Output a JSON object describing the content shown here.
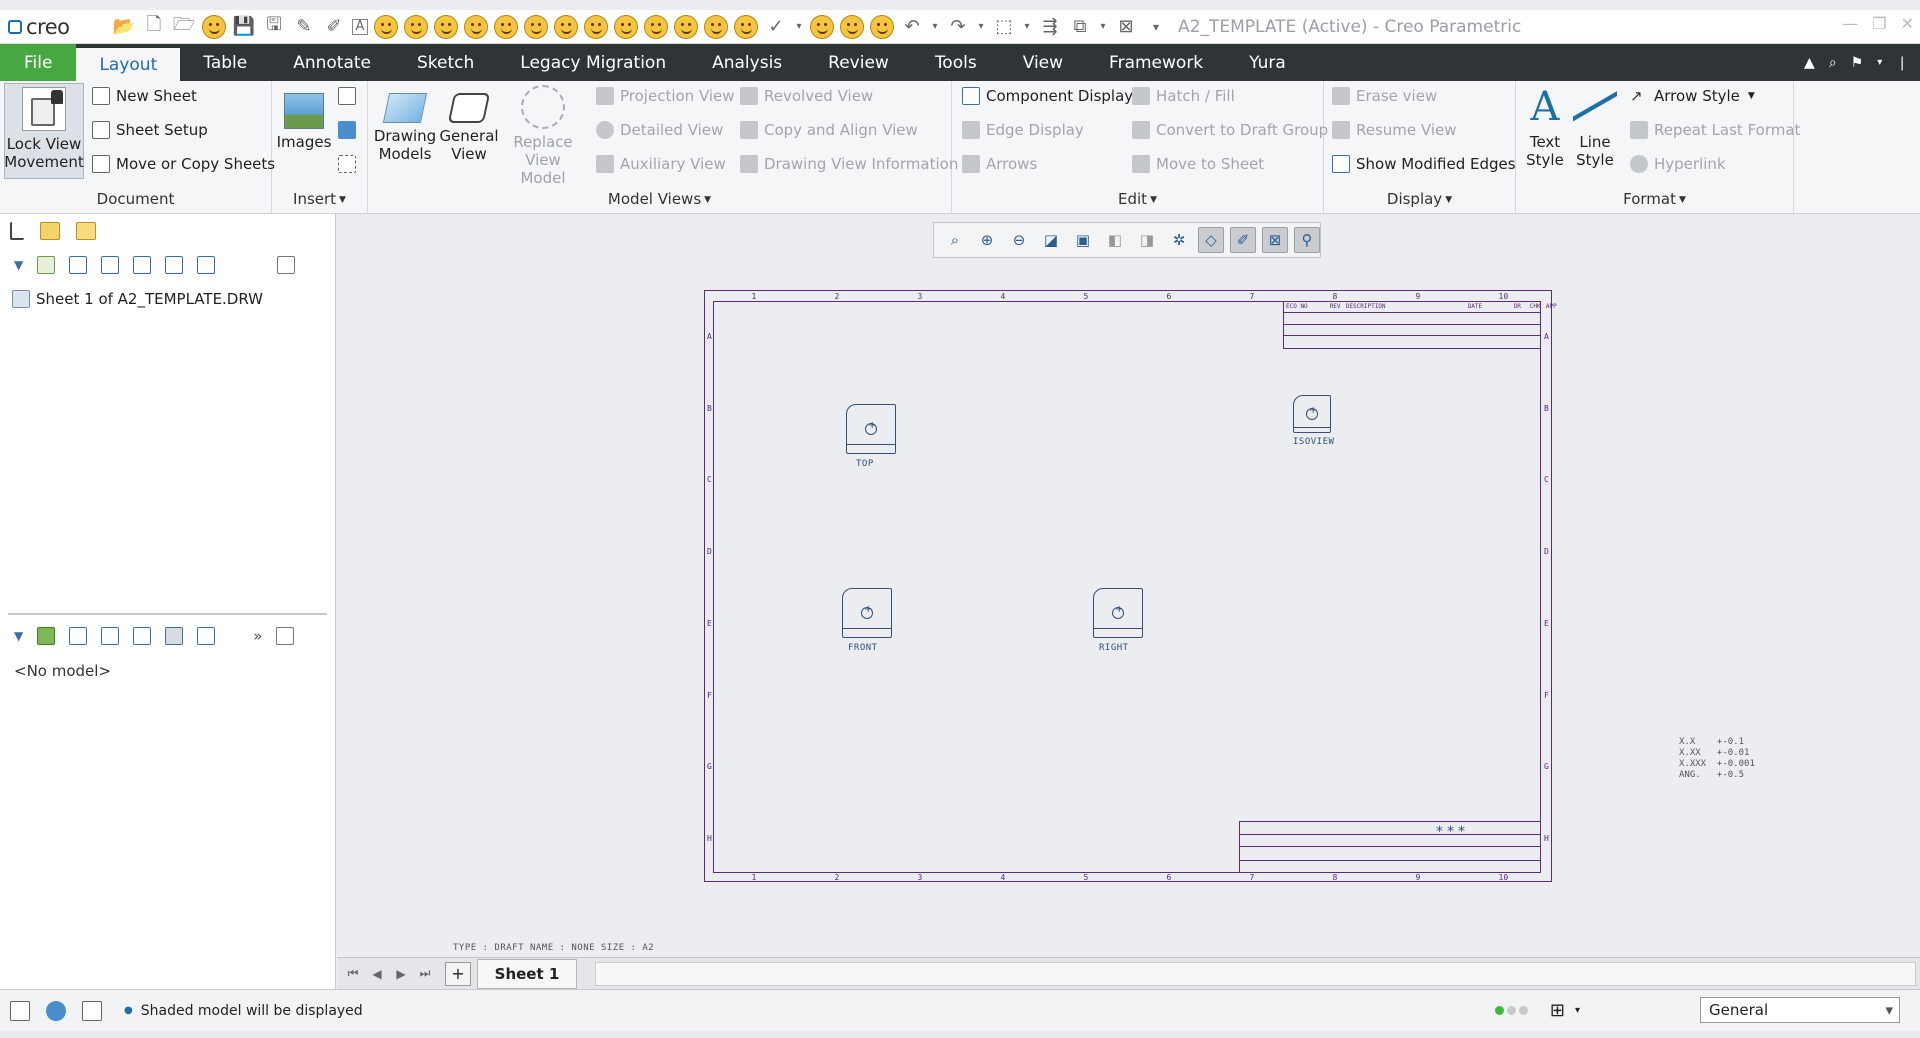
{
  "app": {
    "logo": "creo",
    "window_title": "A2_TEMPLATE (Active) - Creo Parametric"
  },
  "tabs": [
    "File",
    "Layout",
    "Table",
    "Annotate",
    "Sketch",
    "Legacy Migration",
    "Analysis",
    "Review",
    "Tools",
    "View",
    "Framework",
    "Yura"
  ],
  "active_tab": "Layout",
  "ribbon": {
    "document": {
      "label": "Document",
      "lock_view": "Lock View\nMovement",
      "new_sheet": "New Sheet",
      "sheet_setup": "Sheet Setup",
      "move_copy": "Move or Copy Sheets"
    },
    "insert": {
      "label": "Insert",
      "images": "Images"
    },
    "model_views": {
      "label": "Model Views",
      "drawing_models": "Drawing\nModels",
      "general_view": "General\nView",
      "replace_view": "Replace\nView Model",
      "projection_view": "Projection View",
      "detailed_view": "Detailed View",
      "auxiliary_view": "Auxiliary View",
      "revolved_view": "Revolved View",
      "copy_align": "Copy and Align View",
      "drawing_view_info": "Drawing View Information"
    },
    "edit": {
      "label": "Edit",
      "component_display": "Component Display",
      "edge_display": "Edge Display",
      "arrows": "Arrows",
      "hatch_fill": "Hatch / Fill",
      "convert_draft": "Convert to Draft Group",
      "move_to_sheet": "Move to Sheet"
    },
    "display": {
      "label": "Display",
      "erase_view": "Erase view",
      "resume_view": "Resume View",
      "show_modified": "Show Modified Edges"
    },
    "format": {
      "label": "Format",
      "text_style": "Text\nStyle",
      "line_style": "Line\nStyle",
      "arrow_style": "Arrow Style",
      "repeat_format": "Repeat Last Format",
      "hyperlink": "Hyperlink"
    }
  },
  "left_panel": {
    "tree_item": "Sheet 1 of A2_TEMPLATE.DRW",
    "no_model": "<No model>"
  },
  "drawing": {
    "views": [
      "TOP",
      "ISOVIEW",
      "FRONT",
      "RIGHT"
    ],
    "zones_top": [
      "1",
      "2",
      "3",
      "4",
      "5",
      "6",
      "7",
      "8",
      "9",
      "10"
    ],
    "zones_side": [
      "A",
      "B",
      "C",
      "D",
      "E",
      "F",
      "G",
      "H"
    ],
    "rev_table_headers": [
      "ECO NO",
      "REV",
      "DESCRIPTION",
      "DATE",
      "DR",
      "CHK",
      "APP"
    ],
    "tolerance": "X.X    +-0.1\nX.XX   +-0.01\nX.XXX  +-0.001\nANG.   +-0.5",
    "draft_info": "TYPE : DRAFT  NAME : NONE  SIZE : A2"
  },
  "sheet_tab": "Sheet 1",
  "status": {
    "message": "Shaded model will be displayed",
    "filter": "General"
  }
}
